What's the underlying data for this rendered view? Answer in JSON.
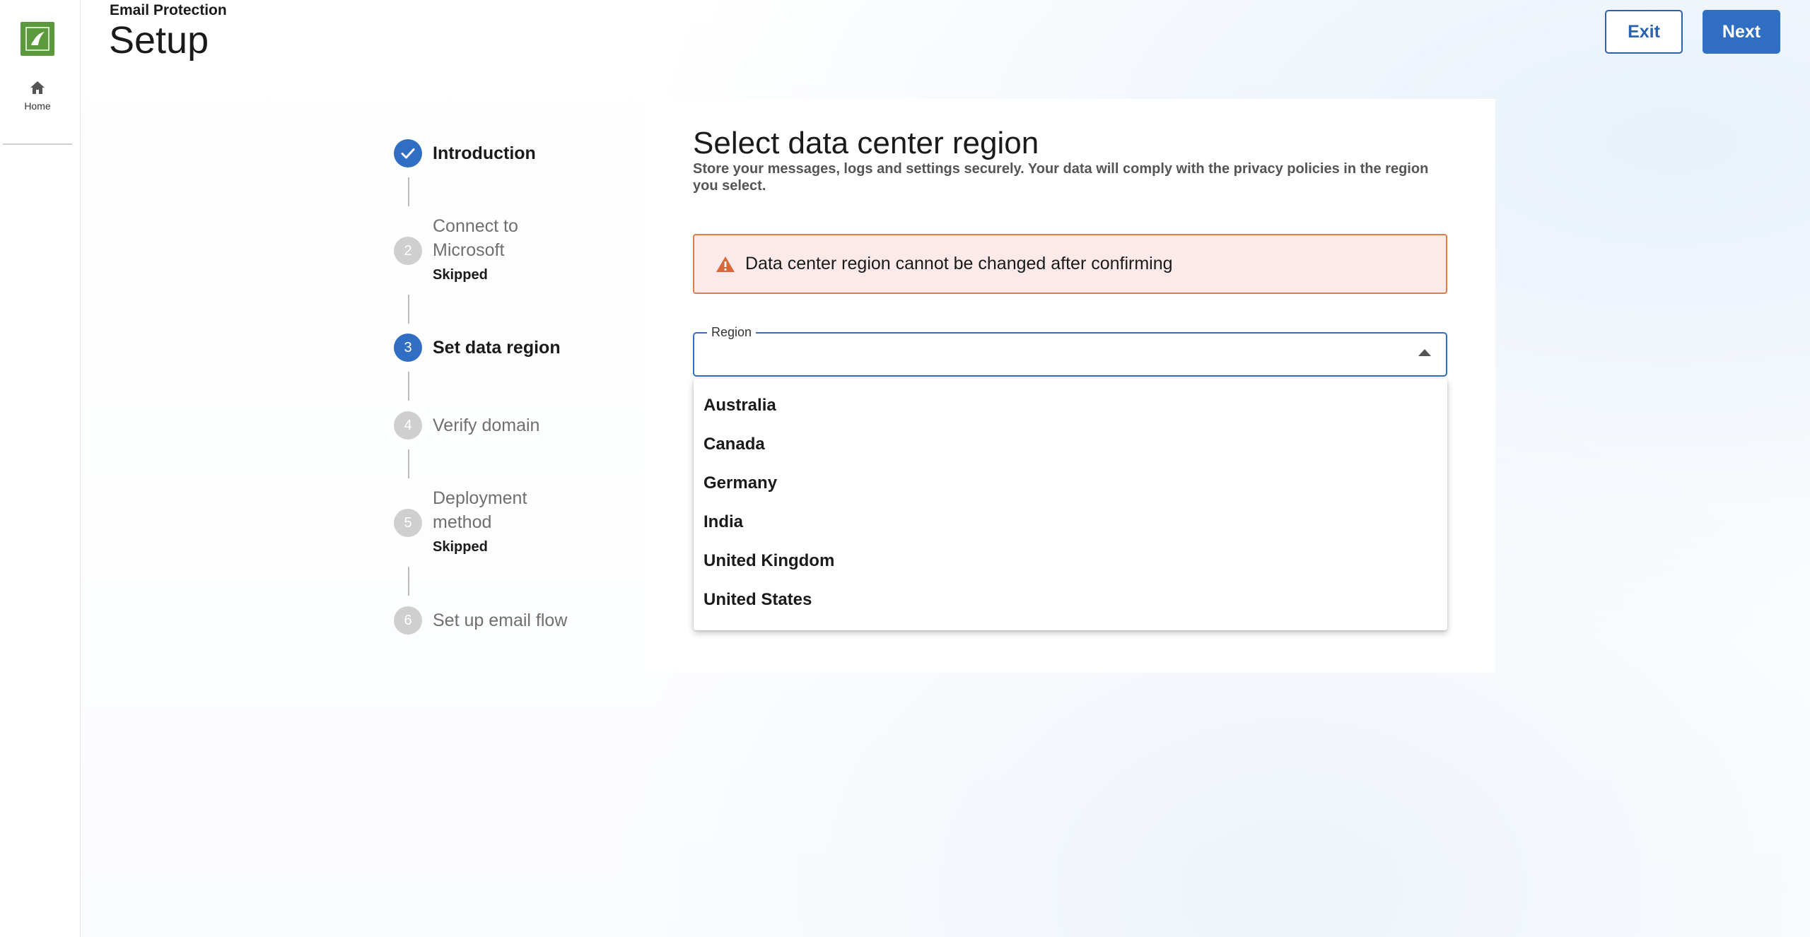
{
  "sidebar": {
    "home_label": "Home"
  },
  "header": {
    "product_name": "Email Protection",
    "title": "Setup",
    "exit_label": "Exit",
    "next_label": "Next"
  },
  "steps": [
    {
      "number": "",
      "label": "Introduction",
      "sub": "",
      "state": "done"
    },
    {
      "number": "2",
      "label_line1": "Connect to",
      "label_line2": "Microsoft",
      "sub": "Skipped",
      "state": "pending"
    },
    {
      "number": "3",
      "label": "Set data region",
      "sub": "",
      "state": "active"
    },
    {
      "number": "4",
      "label": "Verify domain",
      "sub": "",
      "state": "pending"
    },
    {
      "number": "5",
      "label_line1": "Deployment",
      "label_line2": "method",
      "sub": "Skipped",
      "state": "pending"
    },
    {
      "number": "6",
      "label": "Set up email flow",
      "sub": "",
      "state": "pending"
    }
  ],
  "panel": {
    "title": "Select data center region",
    "description": "Store your messages, logs and settings securely. Your data will comply with the privacy policies in the region you select.",
    "warning": "Data center region cannot be changed after confirming",
    "region_label": "Region",
    "region_value": "",
    "options": [
      "Australia",
      "Canada",
      "Germany",
      "India",
      "United Kingdom",
      "United States"
    ]
  },
  "colors": {
    "accent": "#2f6ec3",
    "warning_border": "#e07b4a",
    "warning_bg": "#fbeae9",
    "logo": "#5a9a3c"
  },
  "icons": {
    "logo": "barracuda-logo-icon",
    "home": "home-icon",
    "check": "check-icon",
    "warning": "warning-icon",
    "caret": "caret-up-icon"
  }
}
